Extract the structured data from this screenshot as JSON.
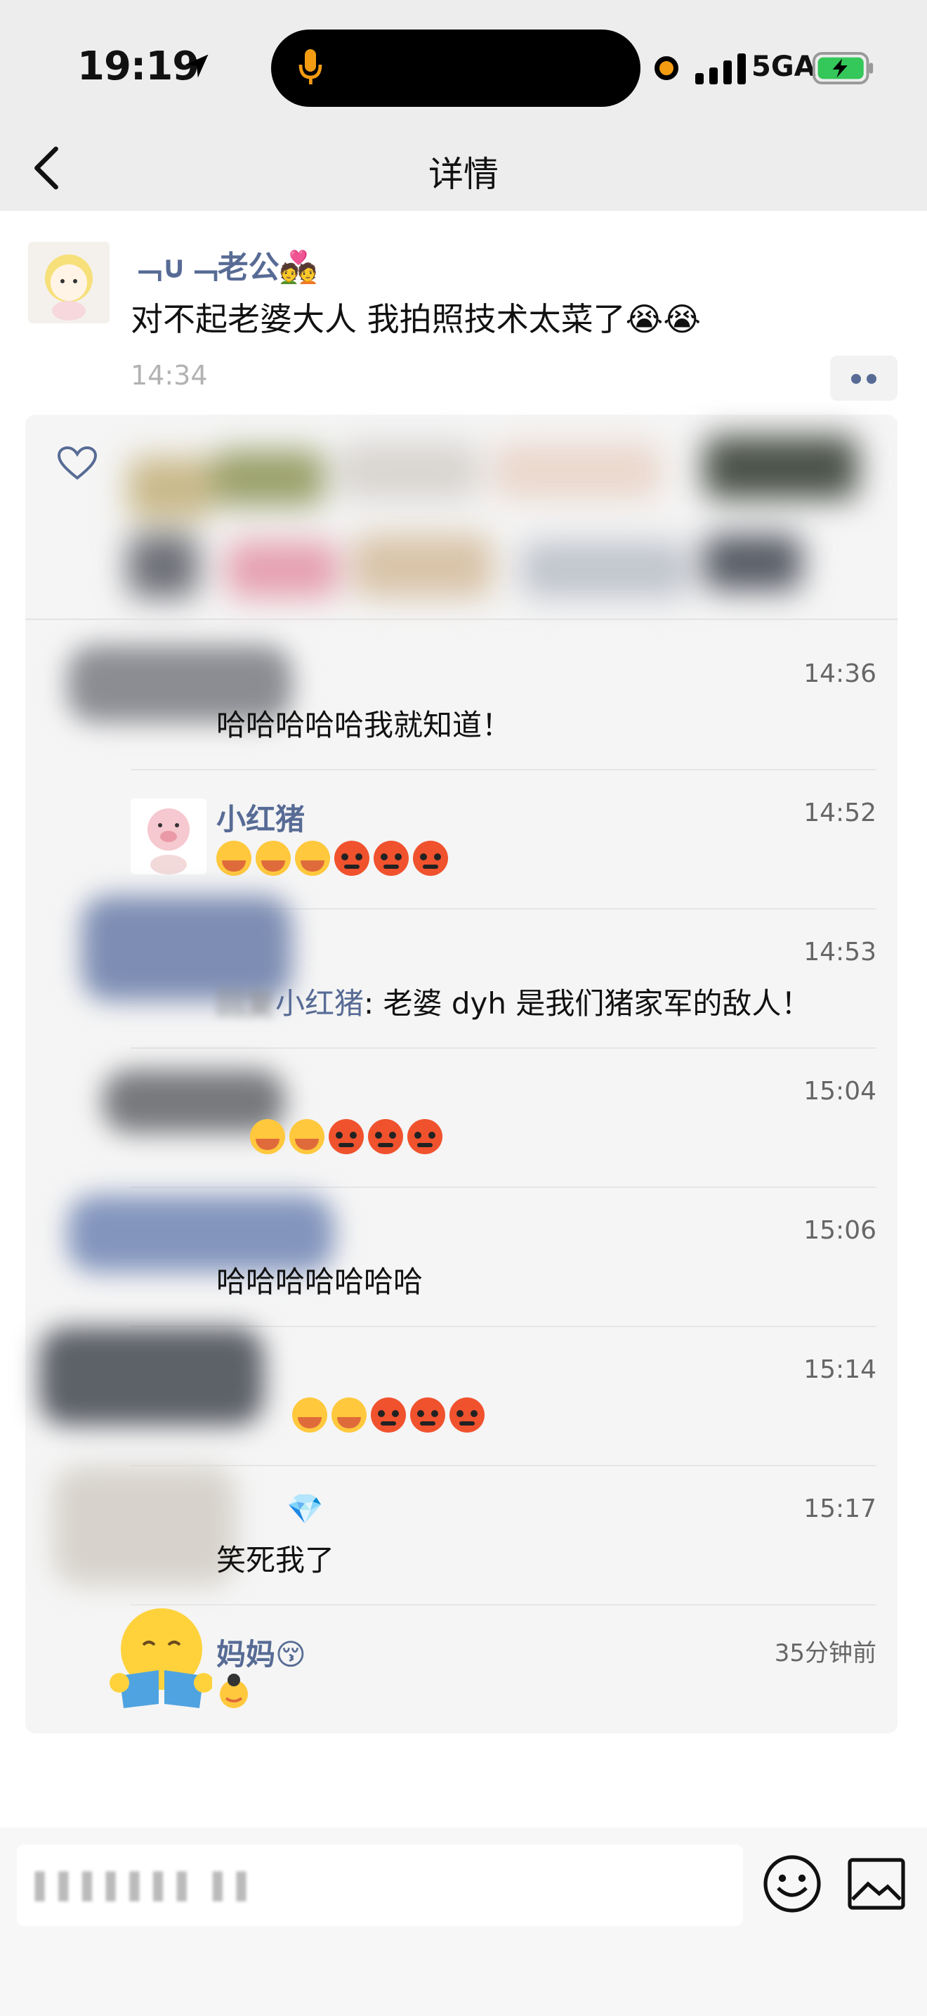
{
  "status_bar": {
    "time": "19:19",
    "network": "5GA"
  },
  "nav": {
    "title": "详情"
  },
  "post": {
    "author": "﹁∪﹁老公💑",
    "content": "对不起老婆大人 我拍照技术太菜了😭😭",
    "time": "14:34"
  },
  "comments": [
    {
      "name": "",
      "text": "哈哈哈哈哈我就知道！",
      "time": "14:36"
    },
    {
      "name": "小红猪",
      "text": "",
      "time": "14:52",
      "emojis": [
        "cry",
        "cry",
        "cry",
        "angry",
        "angry",
        "angry"
      ]
    },
    {
      "name": "",
      "reply_to": "小红猪",
      "reply_prefix": "回复",
      "text": ": 老婆 dyh 是我们猪家军的敌人！",
      "time": "14:53"
    },
    {
      "name": "",
      "text": "",
      "time": "15:04",
      "emojis": [
        "cry",
        "cry",
        "angry",
        "angry",
        "angry"
      ]
    },
    {
      "name": "",
      "text": "哈哈哈哈哈哈哈",
      "time": "15:06"
    },
    {
      "name": "",
      "text": "",
      "time": "15:14",
      "emojis": [
        "cry",
        "cry",
        "cry",
        "angry",
        "angry",
        "angry"
      ]
    },
    {
      "name": "💎",
      "text": "笑死我了",
      "time": "15:17"
    },
    {
      "name": "妈妈😚",
      "text": "",
      "time": "35分钟前"
    }
  ],
  "colors": {
    "link": "#576b95",
    "panel": "#f5f5f5",
    "bar": "#ededed"
  },
  "icons": [
    "location-arrow-icon",
    "mic-icon",
    "signal-icon",
    "battery-icon",
    "back-icon",
    "heart-icon",
    "more-icon",
    "emoji-icon",
    "image-icon"
  ]
}
